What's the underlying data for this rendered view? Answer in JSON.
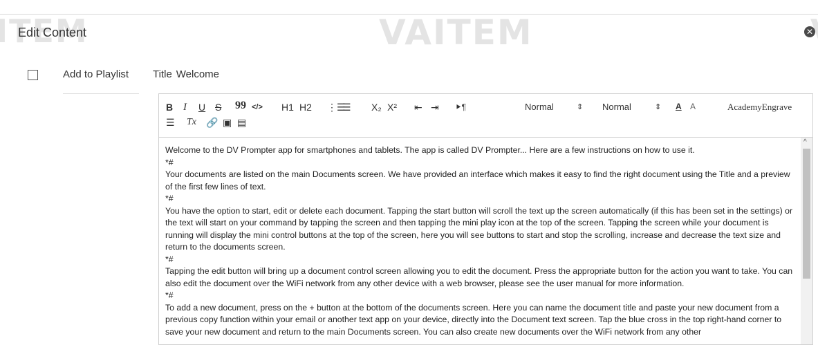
{
  "watermark": {
    "left": "ITEM",
    "center": "VAITEM",
    "right": "V"
  },
  "dialog": {
    "title": "Edit Content",
    "close_icon": "close-circle-icon"
  },
  "playlist": {
    "label": "Add to Playlist",
    "checked": false
  },
  "title_field": {
    "label": "Title",
    "value": "Welcome"
  },
  "toolbar": {
    "bold": "B",
    "italic": "I",
    "underline": "U",
    "strike": "S",
    "blockquote": "99",
    "code": "</>",
    "h1": "H1",
    "h2": "H2",
    "ordered_list": "⋮☰",
    "bullet_list": "☰",
    "subscript": "X₂",
    "superscript": "X²",
    "outdent": "⇤",
    "indent": "⇥",
    "direction": "⯈¶",
    "size_select": "Normal",
    "header_select": "Normal",
    "select_caret": "⇕",
    "text_color": "A",
    "background_color": "A",
    "font_select": "AcademyEngrave",
    "align": "☰",
    "clean": "Tx",
    "link": "🔗",
    "image": "▣",
    "video": "▤"
  },
  "editor": {
    "paragraphs": [
      "Welcome to the DV Prompter app for smartphones and tablets. The app is called DV Prompter... Here are a few instructions on how to use it.",
      "*#",
      "Your documents are listed on the main Documents screen. We have provided an interface which makes it easy to find the right document using the Title and a preview of the first few lines of text.",
      "*#",
      "You have the option to start, edit or delete each document. Tapping the start button will scroll the text up the screen automatically (if this has been set in the settings) or the text will start on your command by tapping the screen and then tapping the mini play icon at the top of the screen. Tapping the screen while your document is running will display the mini control buttons at the top of the screen, here you will see buttons to start and stop the scrolling, increase and decrease the text size and return to the documents screen.",
      "*#",
      "Tapping the edit button will bring up a document control screen allowing you to edit the document. Press the appropriate button for the action you want to take. You can also edit the document over the WiFi network from any other device with a web browser, please see the user manual for more information.",
      "*#",
      "To add a new document, press on the + button at the bottom of the documents screen. Here you can name the document title and paste your new document from a previous copy function within your email or another text app on your device, directly into the Document text screen. Tap the blue cross in the top right-hand corner to save your new document and return to the main Documents screen. You can also create new documents over the WiFi network from any other"
    ],
    "scroll_up": "^"
  }
}
